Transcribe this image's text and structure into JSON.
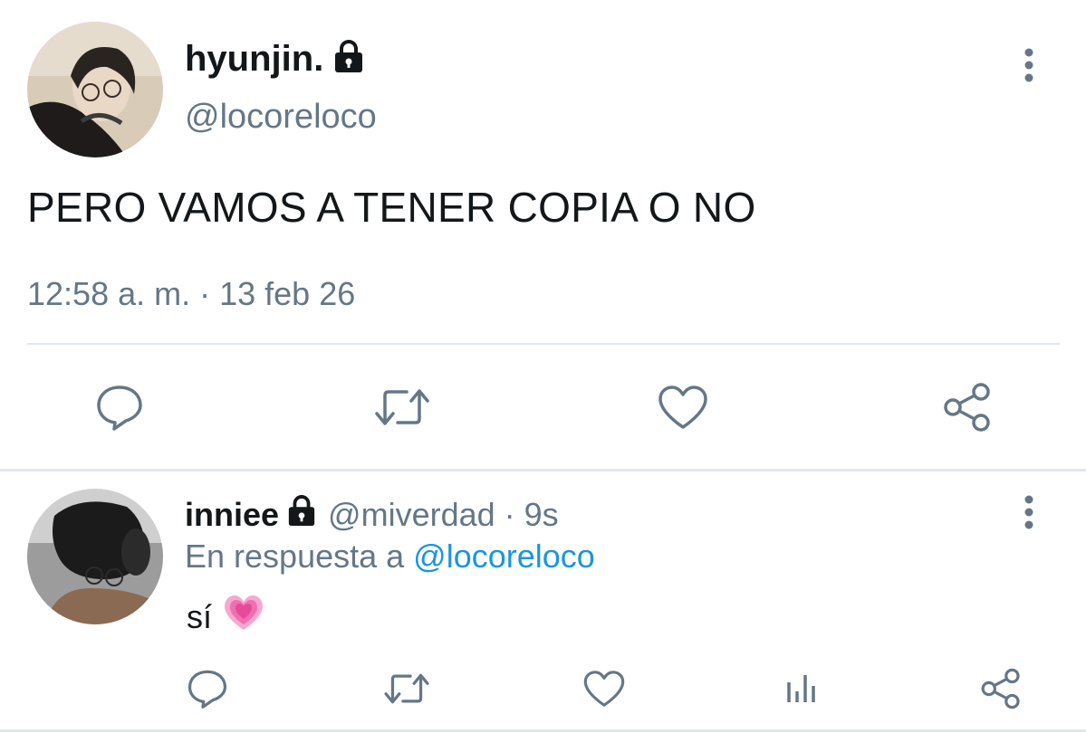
{
  "main_tweet": {
    "display_name": "hyunjin.",
    "handle": "@locoreloco",
    "text": "PERO VAMOS A TENER COPIA O NO",
    "timestamp": "12:58 a. m. · 13 feb 26",
    "protected": true
  },
  "reply": {
    "display_name": "inniee",
    "handle": "@miverdad",
    "separator": "·",
    "time_ago": "9s",
    "in_reply_prefix": "En respuesta a",
    "in_reply_handle": "@locoreloco",
    "text": "sí",
    "emoji": "growing-heart",
    "protected": true
  },
  "actions_main": [
    "reply-icon",
    "retweet-icon",
    "like-icon",
    "share-icon"
  ],
  "actions_reply": [
    "reply-icon",
    "retweet-icon",
    "like-icon",
    "analytics-icon",
    "share-icon"
  ],
  "colors": {
    "text_primary": "#14171a",
    "text_secondary": "#657786",
    "link": "#1b95e0",
    "divider": "#e1e8ed",
    "icon": "#657786",
    "heart_emoji": "#f06fb0"
  }
}
